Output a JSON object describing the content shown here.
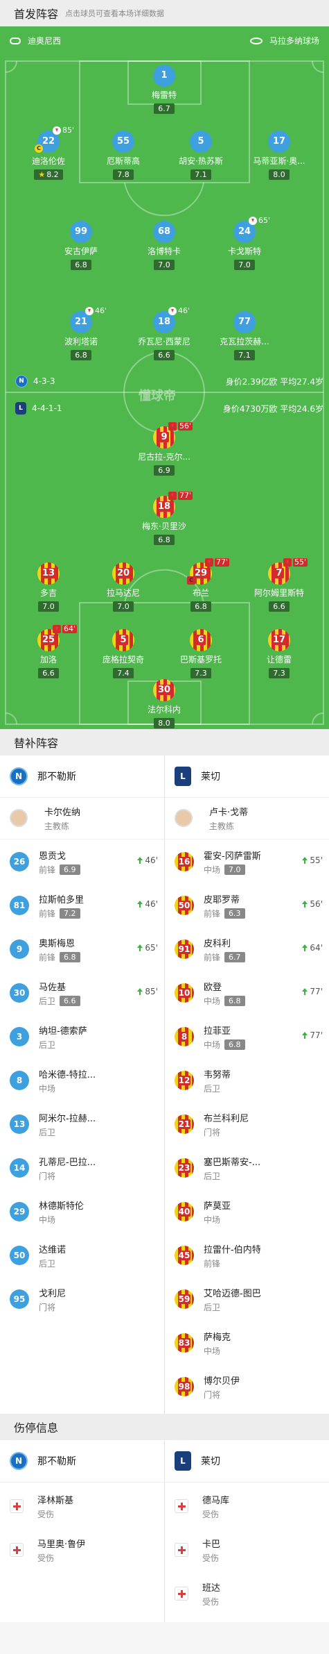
{
  "lineup": {
    "title": "首发阵容",
    "subtitle": "点击球员可查看本场详细数据"
  },
  "pitch": {
    "home_coach": "迪奥尼西",
    "stadium": "马拉多纳球场",
    "watermark": "懂球帝",
    "home_formation": "4-3-3",
    "home_stats": "身价2.39亿欧  平均27.4岁",
    "away_formation": "4-4-1-1",
    "away_stats": "身价4730万欧  平均24.6岁"
  },
  "home_players": [
    {
      "num": "1",
      "name": "梅雷特",
      "rating": "6.7"
    },
    {
      "num": "22",
      "name": "迪洛伦佐",
      "rating": "8.2",
      "sub": "85'",
      "captain": "C",
      "best": true
    },
    {
      "num": "55",
      "name": "厄斯蒂高",
      "rating": "7.8"
    },
    {
      "num": "5",
      "name": "胡安·热苏斯",
      "rating": "7.1"
    },
    {
      "num": "17",
      "name": "马蒂亚斯·奥...",
      "rating": "8.0"
    },
    {
      "num": "99",
      "name": "安古伊萨",
      "rating": "6.8"
    },
    {
      "num": "68",
      "name": "洛博特卡",
      "rating": "7.0"
    },
    {
      "num": "24",
      "name": "卡戈斯特",
      "rating": "7.0",
      "sub": "65'"
    },
    {
      "num": "21",
      "name": "波利塔诺",
      "rating": "6.8",
      "sub": "46'"
    },
    {
      "num": "18",
      "name": "乔瓦尼·西蒙尼",
      "rating": "6.6",
      "sub": "46'"
    },
    {
      "num": "77",
      "name": "克瓦拉茨赫...",
      "rating": "7.1"
    }
  ],
  "away_players": [
    {
      "num": "9",
      "name": "尼古拉-克尔...",
      "rating": "6.9",
      "sub": "56'"
    },
    {
      "num": "18",
      "name": "梅东·贝里沙",
      "rating": "6.8",
      "sub": "77'"
    },
    {
      "num": "13",
      "name": "多吉",
      "rating": "7.0"
    },
    {
      "num": "20",
      "name": "拉马达尼",
      "rating": "7.0"
    },
    {
      "num": "29",
      "name": "布兰",
      "rating": "6.8",
      "sub": "77'",
      "captain": "C"
    },
    {
      "num": "7",
      "name": "阿尔姆里斯特",
      "rating": "6.6",
      "sub": "55'"
    },
    {
      "num": "25",
      "name": "加洛",
      "rating": "6.6",
      "sub": "64'"
    },
    {
      "num": "5",
      "name": "庞格拉契奇",
      "rating": "7.4"
    },
    {
      "num": "6",
      "name": "巴斯基罗托",
      "rating": "7.3"
    },
    {
      "num": "17",
      "name": "让德雷",
      "rating": "7.3"
    },
    {
      "num": "30",
      "name": "法尔科内",
      "rating": "8.0"
    }
  ],
  "subs_section": {
    "title": "替补阵容",
    "home_team": "那不勒斯",
    "away_team": "莱切",
    "home_coach": "卡尔佐纳",
    "away_coach": "卢卡·戈蒂",
    "coach_role": "主教练"
  },
  "home_subs": [
    {
      "num": "26",
      "name": "恩贡戈",
      "pos": "前锋",
      "rating": "6.9",
      "in": "46'"
    },
    {
      "num": "81",
      "name": "拉斯帕多里",
      "pos": "前锋",
      "rating": "7.2",
      "in": "46'"
    },
    {
      "num": "9",
      "name": "奥斯梅恩",
      "pos": "前锋",
      "rating": "6.8",
      "in": "65'"
    },
    {
      "num": "30",
      "name": "马佐基",
      "pos": "后卫",
      "rating": "6.6",
      "in": "85'"
    },
    {
      "num": "3",
      "name": "纳坦-德索萨",
      "pos": "后卫"
    },
    {
      "num": "8",
      "name": "哈米德-特拉...",
      "pos": "中场"
    },
    {
      "num": "13",
      "name": "阿米尔-拉赫...",
      "pos": "后卫"
    },
    {
      "num": "14",
      "name": "孔蒂尼-巴拉...",
      "pos": "门将"
    },
    {
      "num": "29",
      "name": "林德斯特伦",
      "pos": "中场"
    },
    {
      "num": "50",
      "name": "达维诺",
      "pos": "后卫"
    },
    {
      "num": "95",
      "name": "戈利尼",
      "pos": "门将"
    }
  ],
  "away_subs": [
    {
      "num": "16",
      "name": "霍安-冈萨雷斯",
      "pos": "中场",
      "rating": "7.0",
      "in": "55'"
    },
    {
      "num": "50",
      "name": "皮耶罗蒂",
      "pos": "前锋",
      "rating": "6.3",
      "in": "56'"
    },
    {
      "num": "91",
      "name": "皮科利",
      "pos": "前锋",
      "rating": "6.7",
      "in": "64'"
    },
    {
      "num": "10",
      "name": "欧登",
      "pos": "中场",
      "rating": "6.8",
      "in": "77'"
    },
    {
      "num": "8",
      "name": "拉菲亚",
      "pos": "中场",
      "rating": "6.8",
      "in": "77'"
    },
    {
      "num": "12",
      "name": "韦努蒂",
      "pos": "后卫"
    },
    {
      "num": "21",
      "name": "布兰科利尼",
      "pos": "门将"
    },
    {
      "num": "23",
      "name": "塞巴斯蒂安-...",
      "pos": "后卫"
    },
    {
      "num": "40",
      "name": "萨莫亚",
      "pos": "中场"
    },
    {
      "num": "45",
      "name": "拉雷什-伯内特",
      "pos": "前锋"
    },
    {
      "num": "59",
      "name": "艾哈迈德-图巴",
      "pos": "后卫"
    },
    {
      "num": "83",
      "name": "萨梅克",
      "pos": "中场"
    },
    {
      "num": "98",
      "name": "博尔贝伊",
      "pos": "门将"
    }
  ],
  "injury_section": {
    "title": "伤停信息",
    "home_team": "那不勒斯",
    "away_team": "莱切",
    "home": [
      {
        "name": "泽林斯基",
        "status": "受伤"
      },
      {
        "name": "马里奥·鲁伊",
        "status": "受伤"
      }
    ],
    "away": [
      {
        "name": "德马库",
        "status": "受伤"
      },
      {
        "name": "卡巴",
        "status": "受伤"
      },
      {
        "name": "班达",
        "status": "受伤"
      }
    ]
  },
  "colors": {
    "pitch": "#4fb84d",
    "napoli": "#3fa0e0",
    "lecce_red": "#d42a2a",
    "lecce_yellow": "#f4d21a",
    "sub_in": "#3cb043"
  }
}
